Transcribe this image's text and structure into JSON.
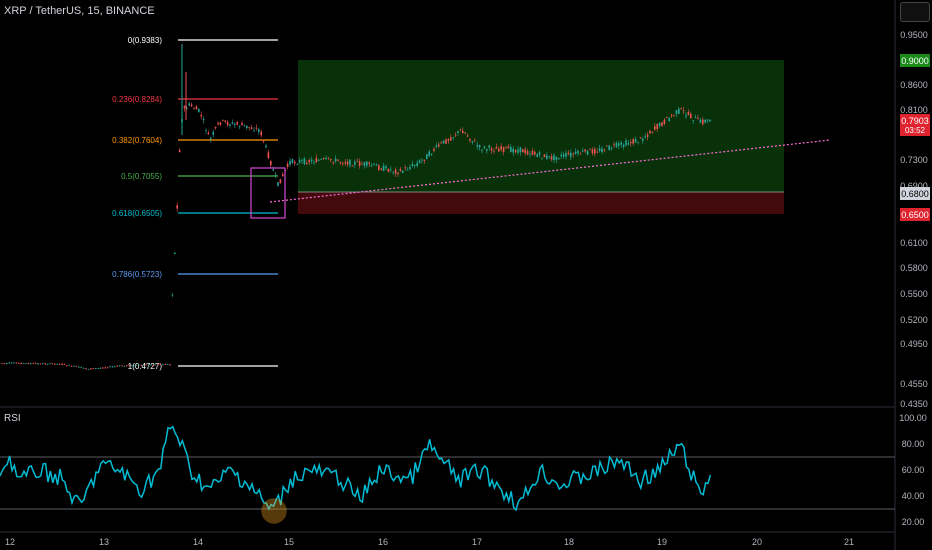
{
  "header": {
    "symbol_title": "XRP / TetherUS, 15, BINANCE"
  },
  "indicator": {
    "label": "RSI"
  },
  "price_axis": {
    "ticks": [
      "0.9500",
      "0.8600",
      "0.8100",
      "0.7300",
      "0.6900",
      "0.6100",
      "0.5800",
      "0.5500",
      "0.5200",
      "0.4950",
      "0.4550",
      "0.4350"
    ],
    "badges": {
      "target": "0.9000",
      "current_price": "0.7903",
      "countdown": "03:52",
      "entry": "0.6800",
      "stop": "0.6500"
    }
  },
  "rsi_axis": {
    "ticks": [
      "100.00",
      "80.00",
      "60.00",
      "40.00",
      "20.00"
    ]
  },
  "time_axis": {
    "ticks": [
      "12",
      "13",
      "14",
      "15",
      "16",
      "17",
      "18",
      "19",
      "20",
      "21"
    ]
  },
  "fib_levels": [
    {
      "label": "0(0.9383)",
      "color": "#ffffff"
    },
    {
      "label": "0.236(0.8284)",
      "color": "#f23645"
    },
    {
      "label": "0.382(0.7604)",
      "color": "#ff9800"
    },
    {
      "label": "0.5(0.7055)",
      "color": "#4caf50"
    },
    {
      "label": "0.618(0.6505)",
      "color": "#00bcd4"
    },
    {
      "label": "0.786(0.5723)",
      "color": "#5b9cf6"
    },
    {
      "label": "1(0.4727)",
      "color": "#ffffff"
    }
  ],
  "colors": {
    "up": "#26a69a",
    "down": "#ef5350",
    "rsi_line": "#00bcd4",
    "profit_zone": "#0b3d0b",
    "loss_zone": "#4a0b0b",
    "trendline": "#ff6bd6",
    "highlight_box": "#d54ad5",
    "circle": "#f5a623"
  }
}
